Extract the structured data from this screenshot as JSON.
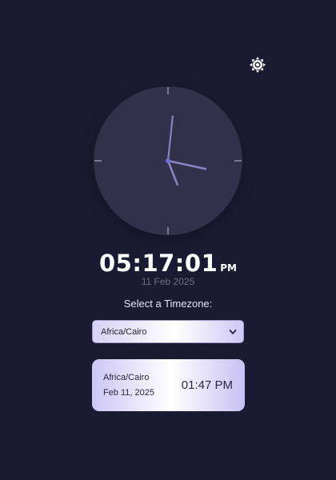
{
  "icons": {
    "theme_toggle": "sun-icon",
    "select_chevron": "chevron-down-icon"
  },
  "colors": {
    "background": "#1b1a33",
    "clock_face": "#32304a",
    "hand_color": "#8784c0",
    "center_dot": "#6f6bd8",
    "accent": "#d6d0f8"
  },
  "clock": {
    "time": "05:17:01",
    "ampm": "PM",
    "date": "11 Feb 2025",
    "hours": 5,
    "minutes": 17,
    "seconds": 1
  },
  "timezone": {
    "label": "Select a Timezone:",
    "selected": "Africa/Cairo"
  },
  "card": {
    "zone": "Africa/Cairo",
    "date": "Feb 11, 2025",
    "time": "01:47 PM"
  }
}
